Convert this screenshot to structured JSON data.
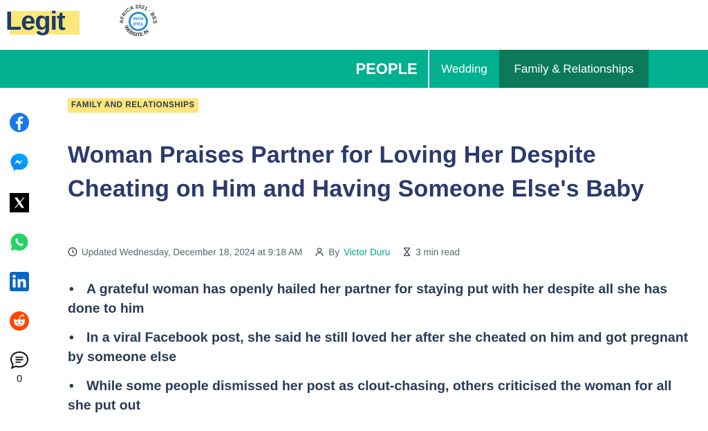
{
  "header": {
    "logo_text": "Legit",
    "badge_text": "BEST NEWS WEBSITE IN AFRICA 2021",
    "badge_inner": "WAN IFRA"
  },
  "nav": {
    "section": "PEOPLE",
    "items": [
      {
        "label": "Wedding",
        "active": false
      },
      {
        "label": "Family & Relationships",
        "active": true
      }
    ]
  },
  "share": {
    "icons": [
      "facebook-icon",
      "messenger-icon",
      "x-icon",
      "whatsapp-icon",
      "linkedin-icon",
      "reddit-icon",
      "comment-icon"
    ],
    "comment_count": "0"
  },
  "article": {
    "category": "FAMILY AND RELATIONSHIPS",
    "title": "Woman Praises Partner for Loving Her Despite Cheating on Him and Having Someone Else's Baby",
    "updated": "Updated Wednesday, December 18, 2024 at 9:18 AM",
    "by_label": "By",
    "author": "Victor Duru",
    "read_time": "3 min read",
    "bullets": [
      "A grateful woman has openly hailed her partner for staying put with her despite all she has done to him",
      "In a viral Facebook post, she said he still loved her after she cheated on him and got pregnant by someone else",
      "While some people dismissed her post as clout-chasing, others criticised the woman for all she put out"
    ]
  },
  "colors": {
    "brand_green": "#00b08f",
    "nav_active": "#0b7a58",
    "logo_yellow": "#ffe67a",
    "headline": "#2b3a6e",
    "author_link": "#00a383"
  }
}
